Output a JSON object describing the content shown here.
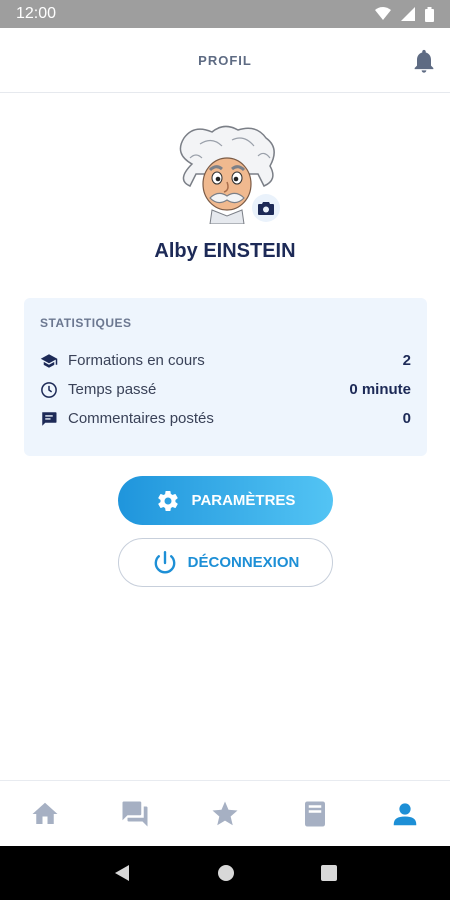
{
  "status_bar": {
    "time": "12:00"
  },
  "header": {
    "title": "PROFIL"
  },
  "profile": {
    "name": "Alby EINSTEIN"
  },
  "stats": {
    "title": "STATISTIQUES",
    "rows": [
      {
        "icon": "graduation-cap-icon",
        "label": "Formations en cours",
        "value": "2"
      },
      {
        "icon": "clock-icon",
        "label": "Temps passé",
        "value": "0 minute"
      },
      {
        "icon": "comment-icon",
        "label": "Commentaires postés",
        "value": "0"
      }
    ]
  },
  "buttons": {
    "params_label": "PARAMÈTRES",
    "logout_label": "DÉCONNEXION"
  },
  "bottom_nav": {
    "items": [
      "home-icon",
      "chat-icon",
      "star-icon",
      "book-icon",
      "user-icon"
    ],
    "active_index": 4,
    "inactive_color": "#a6b0c3",
    "active_color": "#1d8fd6"
  },
  "colors": {
    "accent": "#1d8fd6",
    "text_dark": "#1d2a57",
    "card_bg": "#eef5fd"
  }
}
